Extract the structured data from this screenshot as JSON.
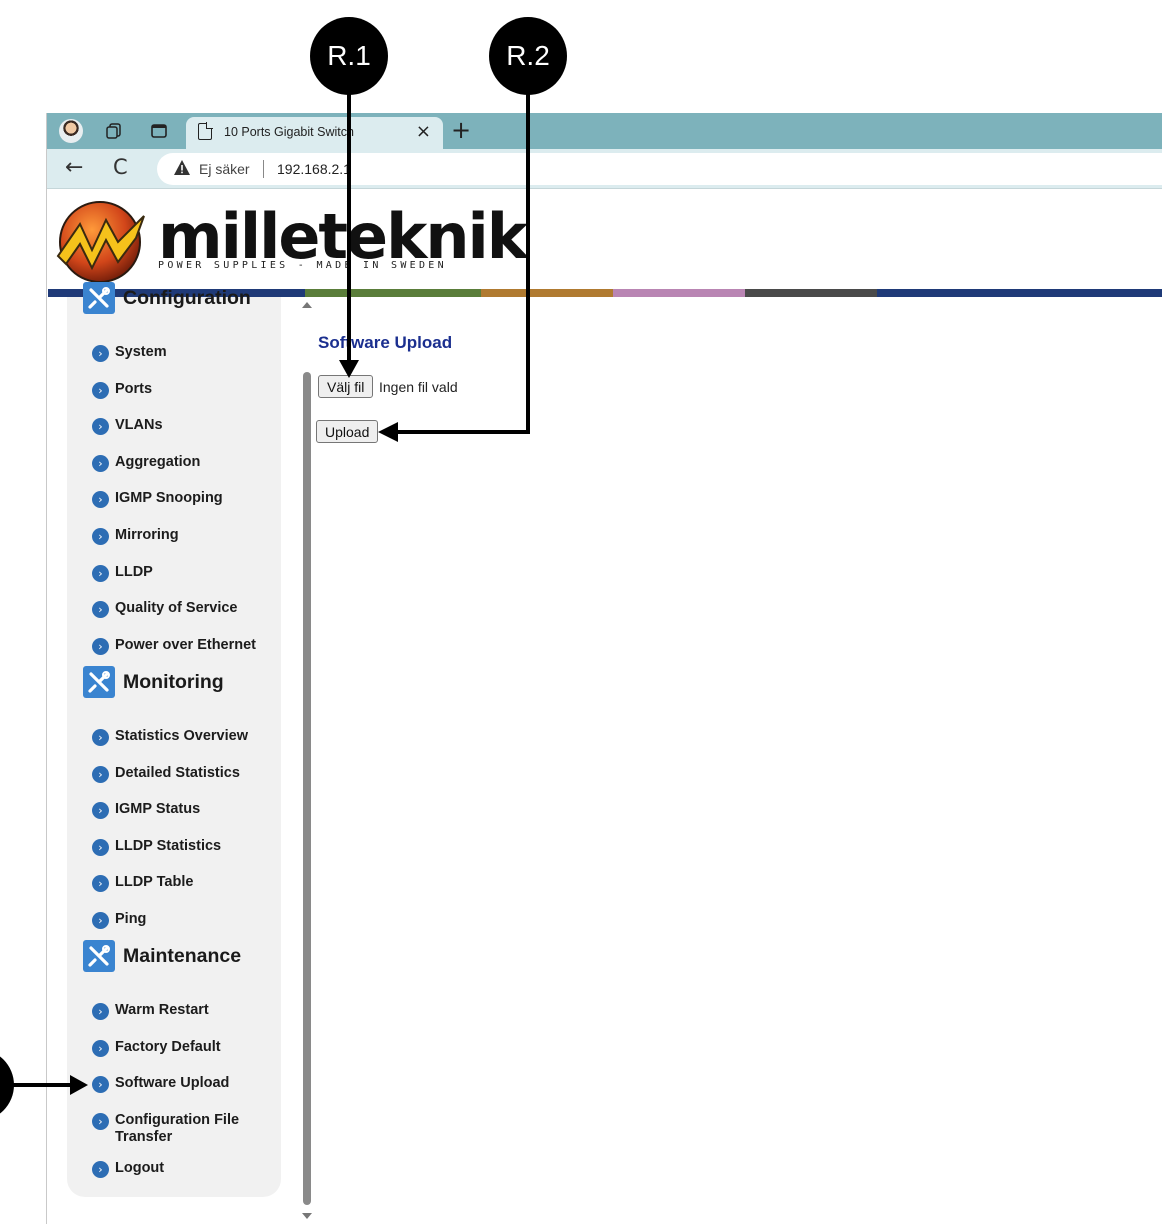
{
  "browser": {
    "tab_title": "10 Ports Gigabit Switch",
    "tab_close": "×",
    "new_tab": "+",
    "back": "←",
    "refresh": "C",
    "security_label": "Ej säker",
    "url": "192.168.2.1"
  },
  "header": {
    "logo_text": "milleteknik",
    "logo_tagline": "POWER SUPPLIES - MADE IN SWEDEN",
    "strip_colors": [
      "#1f3a78",
      "#5a7d3a",
      "#b07a30",
      "#b985b3",
      "#4a4a4a",
      "#1f3a78"
    ]
  },
  "sidebar": {
    "sections": [
      {
        "title": "Configuration",
        "items": [
          "System",
          "Ports",
          "VLANs",
          "Aggregation",
          "IGMP Snooping",
          "Mirroring",
          "LLDP",
          "Quality of Service",
          "Power over Ethernet"
        ]
      },
      {
        "title": "Monitoring",
        "items": [
          "Statistics Overview",
          "Detailed Statistics",
          "IGMP Status",
          "LLDP Statistics",
          "LLDP Table",
          "Ping"
        ]
      },
      {
        "title": "Maintenance",
        "items": [
          "Warm Restart",
          "Factory Default",
          "Software Upload",
          "Configuration File Transfer",
          "Logout"
        ]
      }
    ]
  },
  "main": {
    "title": "Software Upload",
    "choose_file_label": "Välj fil",
    "file_status": "Ingen fil vald",
    "upload_label": "Upload"
  },
  "annotations": {
    "r1": "R.1",
    "r2": "R.2"
  },
  "colors": {
    "accent_blue": "#2d6db4",
    "title_blue": "#1b2f8f",
    "tabbar": "#7db2bb"
  }
}
